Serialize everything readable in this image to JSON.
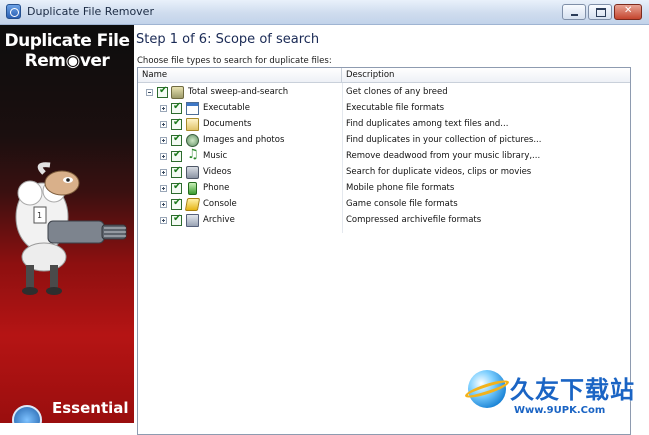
{
  "window": {
    "title": "Duplicate File Remover"
  },
  "banner": {
    "logo_line1": "Duplicate File",
    "logo_line2": "Rem◉ver",
    "bottom_text": "Essential"
  },
  "main": {
    "step_title": "Step 1 of 6: Scope of search",
    "hint": "Choose file types to search for duplicate files:",
    "columns": {
      "name": "Name",
      "description": "Description"
    },
    "root": {
      "label": "Total sweep-and-search",
      "description": "Get clones of any breed",
      "checked": true
    },
    "items": [
      {
        "label": "Executable",
        "description": "Executable file formats",
        "icon": "executable-icon",
        "checked": true
      },
      {
        "label": "Documents",
        "description": "Find duplicates among text files and...",
        "icon": "documents-icon",
        "checked": true
      },
      {
        "label": "Images and photos",
        "description": "Find duplicates in your collection of pictures...",
        "icon": "images-icon",
        "checked": true
      },
      {
        "label": "Music",
        "description": "Remove deadwood from your music library,...",
        "icon": "music-icon",
        "checked": true
      },
      {
        "label": "Videos",
        "description": "Search for duplicate videos, clips or movies",
        "icon": "videos-icon",
        "checked": true
      },
      {
        "label": "Phone",
        "description": "Mobile phone file formats",
        "icon": "phone-icon",
        "checked": true
      },
      {
        "label": "Console",
        "description": "Game console file formats",
        "icon": "console-icon",
        "checked": true
      },
      {
        "label": "Archive",
        "description": "Compressed archivefile formats",
        "icon": "archive-icon",
        "checked": true
      }
    ]
  },
  "watermark": {
    "text": "久友下载站",
    "url": "Www.9UPK.Com"
  }
}
